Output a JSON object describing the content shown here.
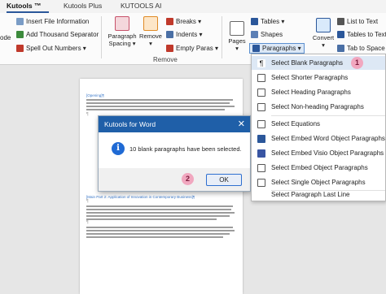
{
  "tabs": [
    "Kutools ™",
    "Kutools Plus",
    "KUTOOLS AI"
  ],
  "ribbon": {
    "left_items": [
      "Insert File Information",
      "Add Thousand Separator",
      "Spell Out Numbers ▾"
    ],
    "left_truncated_label": "ode",
    "paragraph_spacing_label": "Paragraph Spacing ▾",
    "remove_label": "Remove ▾",
    "breaks_label": "Breaks ▾",
    "indents_label": "Indents ▾",
    "empty_paras_label": "Empty Paras ▾",
    "remove_group_label": "Remove",
    "pages_label": "Pages ▾",
    "tables_label": "Tables ▾",
    "shapes_label": "Shapes",
    "paragraphs_label": "Paragraphs ▾",
    "convert_label": "Convert ▾",
    "list_to_text_label": "List to Text",
    "tables_to_text_label": "Tables to Text",
    "tab_to_space_label": "Tab to Space"
  },
  "menu": {
    "items": [
      "Select Blank Paragraphs",
      "Select Shorter Paragraphs",
      "Select Heading Paragraphs",
      "Select Non-heading Paragraphs",
      "Select Equations",
      "Select Embed Word Object Paragraphs",
      "Select Embed Visio Object Paragraphs",
      "Select Embed Object Paragraphs",
      "Select Single Object Paragraphs",
      "Select Paragraph Last Line"
    ]
  },
  "dialog": {
    "title": "Kutools for Word",
    "close_glyph": "✕",
    "message": "10 blank paragraphs have been selected.",
    "ok_label": "OK",
    "info_glyph": "i"
  },
  "badges": {
    "menu": "1",
    "dialog": "2"
  },
  "document": {
    "opening": "[Opening]¶",
    "main_part": "[Main Part 2: Application of Innovation in Contemporary Business]¶"
  },
  "colors": {
    "accent": "#2b579a",
    "dialog_title": "#1f5fa8",
    "badge": "#f1a7bf",
    "heading": "#3a78c9"
  }
}
